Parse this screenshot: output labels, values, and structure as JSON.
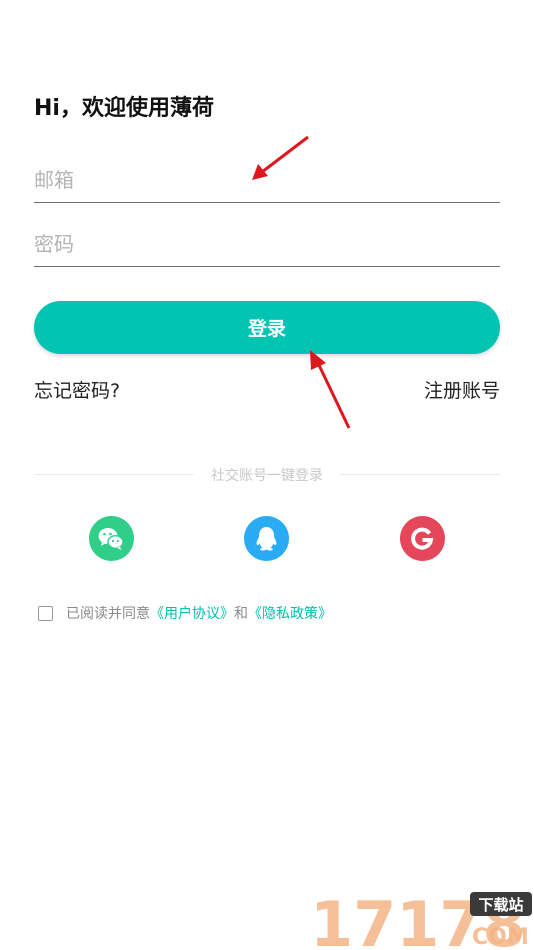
{
  "welcome_title": "Hi，欢迎使用薄荷",
  "email": {
    "placeholder": "邮箱",
    "value": ""
  },
  "password": {
    "placeholder": "密码",
    "value": ""
  },
  "login_button": "登录",
  "forgot_password": "忘记密码?",
  "register": "注册账号",
  "social_divider": "社交账号一键登录",
  "social": [
    {
      "name": "wechat",
      "icon": "wechat-icon",
      "color": "#2fcf8a"
    },
    {
      "name": "qq",
      "icon": "qq-icon",
      "color": "#2aabf5"
    },
    {
      "name": "google",
      "icon": "google-icon",
      "color": "#e5465a"
    }
  ],
  "agreement": {
    "prefix": "已阅读并同意",
    "user_agreement": "《用户协议》",
    "and": "和",
    "privacy_policy": "《隐私政策》",
    "checked": false
  },
  "watermark": {
    "numbers": "17178",
    "badge": "下载站",
    "suffix": "COM"
  },
  "colors": {
    "accent": "#01c4b3",
    "arrow": "#e0161e"
  }
}
